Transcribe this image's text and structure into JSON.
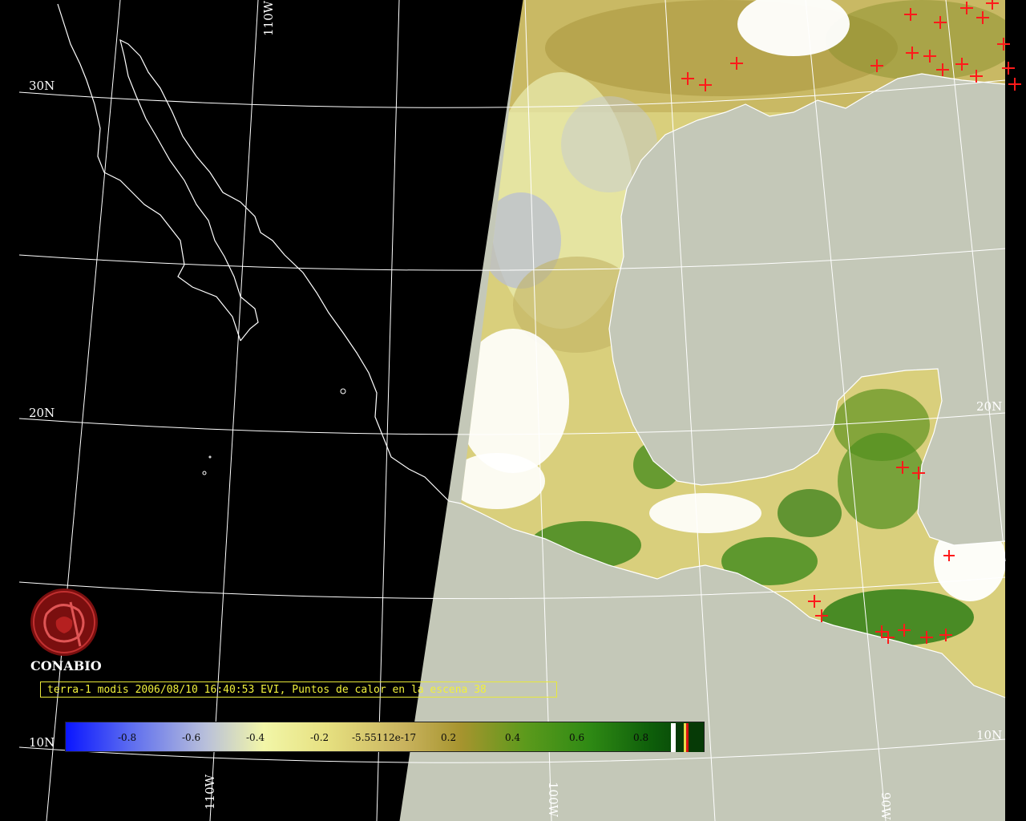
{
  "map": {
    "grid_labels": {
      "lat_30n": "30N",
      "lat_20n_left": "20N",
      "lat_20n_right": "20N",
      "lat_10n_left": "10N",
      "lat_10n_right": "10N",
      "lon_110w_top": "110W",
      "lon_110w_bottom": "110W",
      "lon_100w": "100W",
      "lon_90w": "90W"
    },
    "colors": {
      "background": "#000000",
      "ocean": "#c4c8b8",
      "coastline": "#ffffff",
      "gridline": "#ffffff",
      "hotspot": "#ff1a1a"
    }
  },
  "logo": {
    "name": "CONABIO",
    "icon": "conabio-emblem-icon"
  },
  "caption": "terra-1 modis 2006/08/10 16:40:53 EVI, Puntos de calor en la escena 38",
  "colorbar": {
    "ticks": [
      "-0.8",
      "-0.6",
      "-0.4",
      "-0.2",
      "-5.55112e-17",
      "0.2",
      "0.4",
      "0.6",
      "0.8"
    ]
  }
}
